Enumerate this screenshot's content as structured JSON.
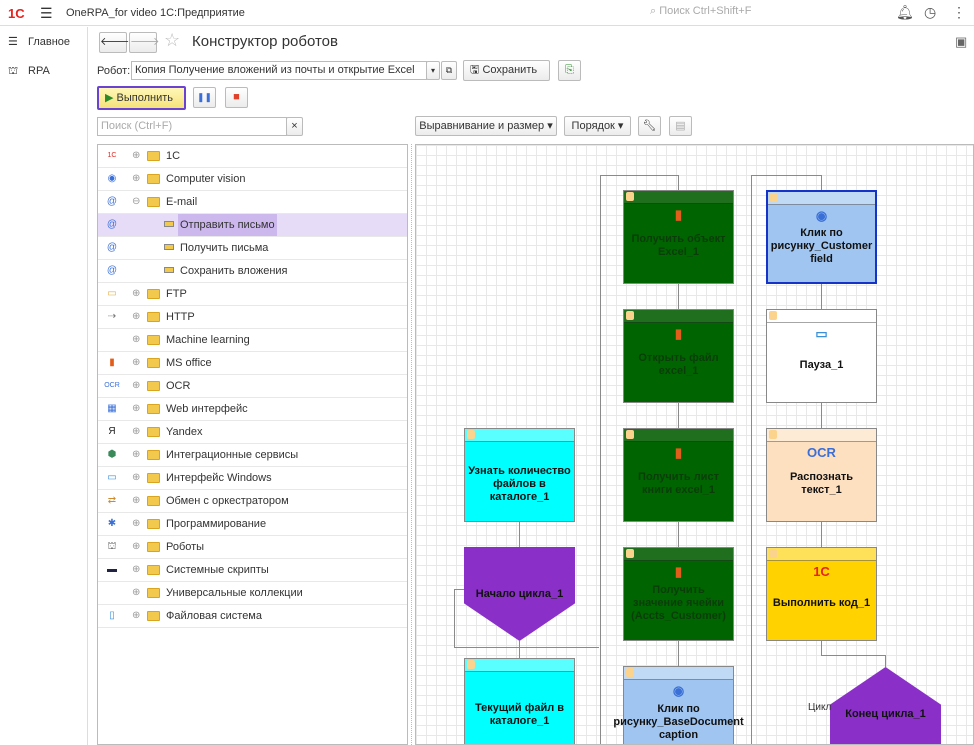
{
  "app": {
    "logo": "1С",
    "title": "OneRPA_for video 1С:Предприятие",
    "search_placeholder": "Поиск Ctrl+Shift+F",
    "bell_icon": "bell-icon",
    "history_icon": "history-icon",
    "more_icon": "more-icon"
  },
  "nav": {
    "items": [
      {
        "label": "Главное",
        "icon": "menu-icon"
      },
      {
        "label": "RPA",
        "icon": "robot-icon"
      }
    ]
  },
  "form": {
    "title": "Конструктор роботов",
    "robot_label": "Робот:",
    "robot_value": "Копия Получение вложений из почты и открытие Excel",
    "save_label": "Сохранить",
    "run_label": "Выполнить",
    "tree_search_placeholder": "Поиск (Ctrl+F)",
    "align_label": "Выравнивание и размер",
    "order_label": "Порядок"
  },
  "tree": [
    {
      "label": "1С",
      "level": 0,
      "expander": "⊕",
      "icon": "1c-icon"
    },
    {
      "label": "Computer vision",
      "level": 0,
      "expander": "⊕",
      "icon": "eye-icon"
    },
    {
      "label": "E-mail",
      "level": 0,
      "expander": "⊖",
      "icon": "at-icon"
    },
    {
      "label": "Отправить письмо",
      "level": 1,
      "icon": "at-icon",
      "selected": true
    },
    {
      "label": "Получить письма",
      "level": 1,
      "icon": "at-icon"
    },
    {
      "label": "Сохранить вложения",
      "level": 1,
      "icon": "at-icon"
    },
    {
      "label": "FTP",
      "level": 0,
      "expander": "⊕",
      "icon": "folder-icon"
    },
    {
      "label": "HTTP",
      "level": 0,
      "expander": "⊕",
      "icon": "http-icon"
    },
    {
      "label": "Machine learning",
      "level": 0,
      "expander": "⊕",
      "icon": ""
    },
    {
      "label": "MS office",
      "level": 0,
      "expander": "⊕",
      "icon": "office-icon"
    },
    {
      "label": "OCR",
      "level": 0,
      "expander": "⊕",
      "icon": "ocr-icon"
    },
    {
      "label": "Web интерфейс",
      "level": 0,
      "expander": "⊕",
      "icon": "web-icon"
    },
    {
      "label": "Yandex",
      "level": 0,
      "expander": "⊕",
      "icon": "yandex-icon"
    },
    {
      "label": "Интеграционные сервисы",
      "level": 0,
      "expander": "⊕",
      "icon": "integration-icon"
    },
    {
      "label": "Интерфейс Windows",
      "level": 0,
      "expander": "⊕",
      "icon": "monitor-icon"
    },
    {
      "label": "Обмен с оркестратором",
      "level": 0,
      "expander": "⊕",
      "icon": "exchange-icon"
    },
    {
      "label": "Программирование",
      "level": 0,
      "expander": "⊕",
      "icon": "code-icon"
    },
    {
      "label": "Роботы",
      "level": 0,
      "expander": "⊕",
      "icon": "robot-icon"
    },
    {
      "label": "Системные скрипты",
      "level": 0,
      "expander": "⊕",
      "icon": "terminal-icon"
    },
    {
      "label": "Универсальные коллекции",
      "level": 0,
      "expander": "⊕",
      "icon": ""
    },
    {
      "label": "Файловая система",
      "level": 0,
      "expander": "⊕",
      "icon": "file-icon"
    }
  ],
  "nodes": [
    {
      "label": "Получить объект Excel_1",
      "color": "#006400",
      "text_color": "#0a3d0a",
      "icon": "office-icon"
    },
    {
      "label": "Открыть файл excel_1",
      "color": "#006400",
      "text_color": "#0a3d0a",
      "icon": "office-icon"
    },
    {
      "label": "Получить лист книги excel_1",
      "color": "#006400",
      "text_color": "#0a3d0a",
      "icon": "office-icon"
    },
    {
      "label": "Получить значение ячейки (Accts_Customer)",
      "color": "#006400",
      "text_color": "#0a3d0a",
      "icon": "office-icon"
    },
    {
      "label": "Клик по рисунку_Customer field",
      "color": "#9fc5f0",
      "text_color": "#111",
      "icon": "eye-icon"
    },
    {
      "label": "Пауза_1",
      "color": "#ffffff",
      "text_color": "#111",
      "icon": "monitor-icon"
    },
    {
      "label": "Распознать текст_1",
      "color": "#fde0c0",
      "text_color": "#111",
      "icon": "ocr-icon"
    },
    {
      "label": "Выполнить код_1",
      "color": "#ffd200",
      "text_color": "#111",
      "icon": "1c-icon"
    },
    {
      "label": "Узнать количество файлов в каталоге_1",
      "color": "#00ffff",
      "text_color": "#111",
      "icon": ""
    },
    {
      "label": "Начало цикла_1",
      "color": "#8b2fc9",
      "text_color": "#111",
      "icon": ""
    },
    {
      "label": "Текущий файл в каталоге_1",
      "color": "#00ffff",
      "text_color": "#111",
      "icon": ""
    },
    {
      "label": "Клик по рисунку_BaseDocument caption",
      "color": "#9fc5f0",
      "text_color": "#111",
      "icon": "eye-icon"
    },
    {
      "label": "Конец цикла_1",
      "color": "#8b2fc9",
      "text_color": "#111",
      "icon": ""
    }
  ],
  "edge_label": "Цикл"
}
